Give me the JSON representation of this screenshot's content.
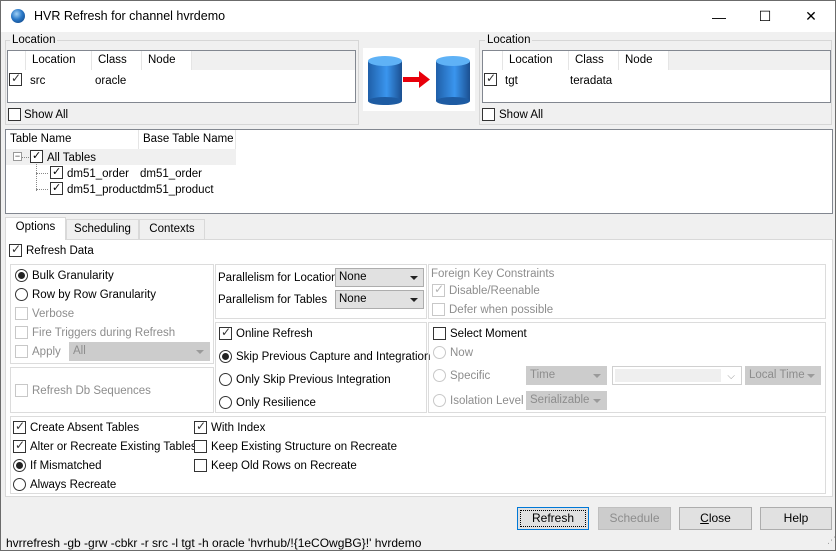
{
  "window": {
    "title": "HVR Refresh for channel hvrdemo",
    "icon": "hvr-globe-icon",
    "controls": {
      "minimize": "—",
      "maximize": "☐",
      "close": "✕"
    }
  },
  "source_location": {
    "group_label": "Location",
    "columns": [
      "Location",
      "Class",
      "Node"
    ],
    "rows": [
      {
        "checked": true,
        "location": "src",
        "class": "oracle",
        "node": ""
      }
    ],
    "show_all_label": "Show All",
    "show_all_checked": false
  },
  "target_location": {
    "group_label": "Location",
    "columns": [
      "Location",
      "Class",
      "Node"
    ],
    "rows": [
      {
        "checked": true,
        "location": "tgt",
        "class": "teradata",
        "node": ""
      }
    ],
    "show_all_label": "Show All",
    "show_all_checked": false
  },
  "diagram": {
    "icon": "database-to-database-icon",
    "arrow_color": "#e8000b",
    "db_color": "#2f86d6"
  },
  "tables": {
    "columns": [
      "Table Name",
      "Base Table Name"
    ],
    "root": {
      "label": "All Tables",
      "checked": true,
      "expanded": true
    },
    "rows": [
      {
        "name": "dm51_order",
        "base": "dm51_order",
        "checked": true
      },
      {
        "name": "dm51_product",
        "base": "dm51_product",
        "checked": true
      }
    ]
  },
  "tabs": [
    {
      "label": "Options",
      "active": true
    },
    {
      "label": "Scheduling",
      "active": false
    },
    {
      "label": "Contexts",
      "active": false
    }
  ],
  "options": {
    "refresh_data": {
      "label": "Refresh Data",
      "checked": true
    },
    "granularity": {
      "bulk": {
        "label": "Bulk Granularity",
        "selected": true
      },
      "row_by_row": {
        "label": "Row by Row Granularity",
        "selected": false
      },
      "verbose": {
        "label": "Verbose",
        "checked": false,
        "disabled": true
      },
      "fire_triggers": {
        "label": "Fire Triggers during Refresh",
        "checked": false,
        "disabled": true
      },
      "apply": {
        "label": "Apply",
        "checked": false,
        "disabled": true,
        "value": "All"
      }
    },
    "refresh_db_sequences": {
      "label": "Refresh Db Sequences",
      "checked": false,
      "disabled": true
    },
    "parallelism": {
      "locations_label": "Parallelism for Locations",
      "locations_value": "None",
      "tables_label": "Parallelism for Tables",
      "tables_value": "None"
    },
    "online_refresh": {
      "label": "Online Refresh",
      "checked": true,
      "choices": [
        {
          "label": "Skip Previous Capture and Integration",
          "selected": true
        },
        {
          "label": "Only Skip Previous Integration",
          "selected": false
        },
        {
          "label": "Only Resilience",
          "selected": false
        }
      ]
    },
    "foreign_keys": {
      "title": "Foreign Key Constraints",
      "disable_reenable": {
        "label": "Disable/Reenable",
        "checked": true,
        "disabled": true
      },
      "defer": {
        "label": "Defer when possible",
        "checked": false,
        "disabled": true
      }
    },
    "select_moment": {
      "label": "Select Moment",
      "checked": false,
      "now_label": "Now",
      "specific_label": "Specific",
      "specific_type": "Time",
      "specific_value": "",
      "timezone": "Local Time",
      "isolation_label": "Isolation Level",
      "isolation_value": "Serializable"
    },
    "table_creation": {
      "create_absent": {
        "label": "Create Absent Tables",
        "checked": true
      },
      "alter_recreate": {
        "label": "Alter or Recreate Existing Tables",
        "checked": true
      },
      "if_mismatched": {
        "label": "If Mismatched",
        "selected": true
      },
      "always_recreate": {
        "label": "Always Recreate",
        "selected": false
      },
      "with_index": {
        "label": "With Index",
        "checked": true
      },
      "keep_structure": {
        "label": "Keep Existing Structure on Recreate",
        "checked": false
      },
      "keep_old_rows": {
        "label": "Keep Old Rows on Recreate",
        "checked": false
      }
    }
  },
  "buttons": {
    "refresh": "Refresh",
    "schedule": "Schedule",
    "close": "Close",
    "close_mnemonic": "C",
    "close_rest": "lose",
    "help": "Help"
  },
  "command_line": "hvrrefresh -gb -grw -cbkr -r src -l tgt -h oracle 'hvrhub/!{1eCOwgBG}!' hvrdemo"
}
